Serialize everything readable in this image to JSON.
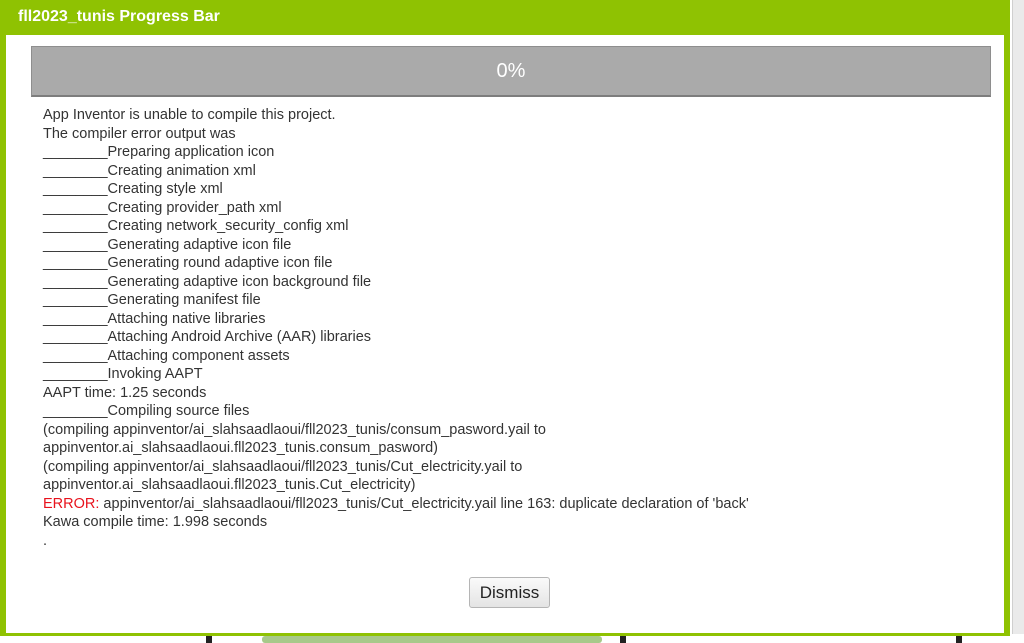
{
  "dialog": {
    "title": "fll2023_tunis Progress Bar",
    "progress": {
      "percent_label": "0%",
      "value": 0
    },
    "log_lines": [
      "App Inventor is unable to compile this project.",
      "The compiler error output was",
      "________Preparing application icon",
      "________Creating animation xml",
      "________Creating style xml",
      "________Creating provider_path xml",
      "________Creating network_security_config xml",
      "________Generating adaptive icon file",
      "________Generating round adaptive icon file",
      "________Generating adaptive icon background file",
      "________Generating manifest file",
      "________Attaching native libraries",
      "________Attaching Android Archive (AAR) libraries",
      "________Attaching component assets",
      "________Invoking AAPT",
      "AAPT time: 1.25 seconds",
      "________Compiling source files",
      "(compiling appinventor/ai_slahsaadlaoui/fll2023_tunis/consum_pasword.yail to",
      "appinventor.ai_slahsaadlaoui.fll2023_tunis.consum_pasword)",
      "(compiling appinventor/ai_slahsaadlaoui/fll2023_tunis/Cut_electricity.yail to",
      "appinventor.ai_slahsaadlaoui.fll2023_tunis.Cut_electricity)"
    ],
    "error_line": {
      "label": "ERROR:",
      "message": " appinventor/ai_slahsaadlaoui/fll2023_tunis/Cut_electricity.yail line 163: duplicate declaration of 'back'"
    },
    "kawa_time": "Kawa compile time: 1.998 seconds",
    "trailing_line": ".",
    "dismiss_label": "Dismiss"
  },
  "colors": {
    "frame_green": "#8fc202",
    "progress_gray": "#aaaaaa",
    "error_red": "#e8121c"
  }
}
